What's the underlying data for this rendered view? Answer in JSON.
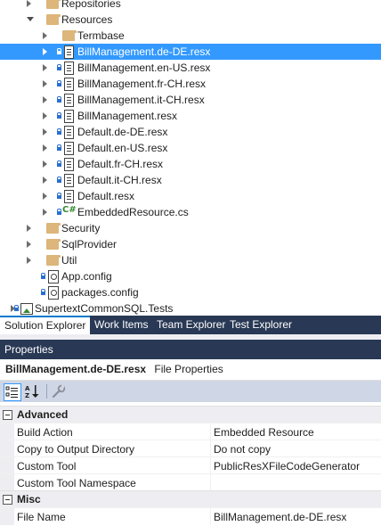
{
  "tree": {
    "items": [
      {
        "label": "Repositories",
        "type": "folder",
        "expander": "collapsed",
        "lock": false,
        "indent": 1
      },
      {
        "label": "Resources",
        "type": "folder",
        "expander": "expanded",
        "lock": false,
        "indent": 1
      },
      {
        "label": "Termbase",
        "type": "folder",
        "expander": "collapsed",
        "lock": false,
        "indent": 2
      },
      {
        "label": "BillManagement.de-DE.resx",
        "type": "resx",
        "expander": "collapsed",
        "lock": true,
        "indent": 2,
        "selected": true
      },
      {
        "label": "BillManagement.en-US.resx",
        "type": "resx",
        "expander": "collapsed",
        "lock": true,
        "indent": 2
      },
      {
        "label": "BillManagement.fr-CH.resx",
        "type": "resx",
        "expander": "collapsed",
        "lock": true,
        "indent": 2
      },
      {
        "label": "BillManagement.it-CH.resx",
        "type": "resx",
        "expander": "collapsed",
        "lock": true,
        "indent": 2
      },
      {
        "label": "BillManagement.resx",
        "type": "resx",
        "expander": "collapsed",
        "lock": true,
        "indent": 2
      },
      {
        "label": "Default.de-DE.resx",
        "type": "resx",
        "expander": "collapsed",
        "lock": true,
        "indent": 2
      },
      {
        "label": "Default.en-US.resx",
        "type": "resx",
        "expander": "collapsed",
        "lock": true,
        "indent": 2
      },
      {
        "label": "Default.fr-CH.resx",
        "type": "resx",
        "expander": "collapsed",
        "lock": true,
        "indent": 2
      },
      {
        "label": "Default.it-CH.resx",
        "type": "resx",
        "expander": "collapsed",
        "lock": true,
        "indent": 2
      },
      {
        "label": "Default.resx",
        "type": "resx",
        "expander": "collapsed",
        "lock": true,
        "indent": 2
      },
      {
        "label": "EmbeddedResource.cs",
        "type": "cs",
        "expander": "collapsed",
        "lock": true,
        "indent": 2
      },
      {
        "label": "Security",
        "type": "folder",
        "expander": "collapsed",
        "lock": false,
        "indent": 1
      },
      {
        "label": "SqlProvider",
        "type": "folder",
        "expander": "collapsed",
        "lock": false,
        "indent": 1
      },
      {
        "label": "Util",
        "type": "folder",
        "expander": "collapsed",
        "lock": false,
        "indent": 1
      },
      {
        "label": "App.config",
        "type": "config",
        "expander": "none",
        "lock": true,
        "indent": 1
      },
      {
        "label": "packages.config",
        "type": "config",
        "expander": "none",
        "lock": true,
        "indent": 1
      },
      {
        "label": "SupertextCommonSQL.Tests",
        "type": "project",
        "expander": "collapsed",
        "lock": true,
        "indent": 0
      }
    ]
  },
  "tabs": [
    {
      "label": "Solution Explorer",
      "active": true
    },
    {
      "label": "Work Items",
      "active": false
    },
    {
      "label": "Team Explorer",
      "active": false
    },
    {
      "label": "Test Explorer",
      "active": false
    }
  ],
  "properties": {
    "title": "Properties",
    "object_name": "BillManagement.de-DE.resx",
    "object_kind": "File Properties",
    "toolbar": {
      "categorized_icon": "categorized-icon",
      "alphabetical_icon": "alphabetical-icon",
      "property_pages_icon": "wrench-icon"
    },
    "categories": [
      {
        "name": "Advanced",
        "rows": [
          {
            "name": "Build Action",
            "value": "Embedded Resource"
          },
          {
            "name": "Copy to Output Directory",
            "value": "Do not copy"
          },
          {
            "name": "Custom Tool",
            "value": "PublicResXFileCodeGenerator"
          },
          {
            "name": "Custom Tool Namespace",
            "value": ""
          }
        ]
      },
      {
        "name": "Misc",
        "rows": [
          {
            "name": "File Name",
            "value": "BillManagement.de-DE.resx"
          }
        ]
      }
    ]
  },
  "colors": {
    "selection": "#3399ff",
    "tool_window_header": "#293955",
    "folder": "#dcb67a",
    "lock": "#2a6fd1"
  }
}
